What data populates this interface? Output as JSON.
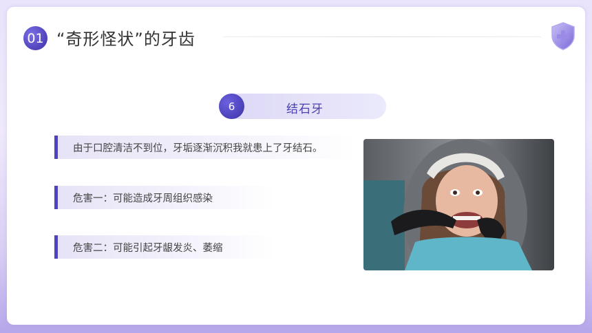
{
  "header": {
    "section_number": "01",
    "title": "“奇形怪状”的牙齿"
  },
  "item": {
    "number": "6",
    "label": "结石牙"
  },
  "bullets": [
    "由于口腔清洁不到位，牙垢逐渐沉积我就患上了牙结石。",
    "危害一：可能造成牙周组织感染",
    "危害二：可能引起牙龈发炎、萎缩"
  ],
  "colors": {
    "accent": "#4f42c0",
    "accent_light": "#dcd8f6",
    "background": "#e9e3fb"
  },
  "icons": {
    "header_icon": "shield-plus-icon"
  }
}
